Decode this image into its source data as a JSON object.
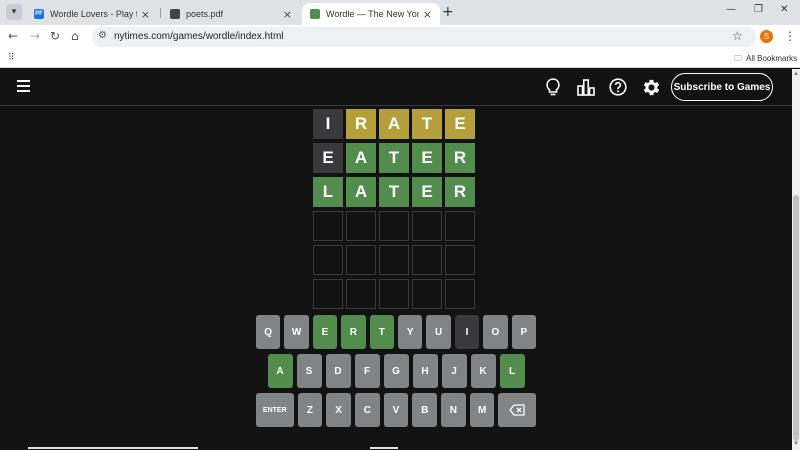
{
  "browser": {
    "tabs": [
      {
        "title": "Wordle Lovers - Play the NYT D",
        "favicon_text": "PF",
        "favicon_color": "#1a73e8",
        "active": false
      },
      {
        "title": "poets.pdf",
        "favicon_text": "",
        "favicon_color": "#444444",
        "active": false
      },
      {
        "title": "Wordle — The New York Times",
        "favicon_text": "",
        "favicon_color": "#538d4e",
        "active": true
      }
    ],
    "url": "nytimes.com/games/wordle/index.html",
    "profile_initial": "S",
    "bookmarks_label": "All Bookmarks"
  },
  "header": {
    "subscribe_label": "Subscribe to Games",
    "icons": [
      "menu-icon",
      "lightbulb-icon",
      "stats-icon",
      "help-icon",
      "settings-icon"
    ]
  },
  "board": {
    "rows": [
      [
        {
          "l": "I",
          "s": "absent"
        },
        {
          "l": "R",
          "s": "present"
        },
        {
          "l": "A",
          "s": "present"
        },
        {
          "l": "T",
          "s": "present"
        },
        {
          "l": "E",
          "s": "present"
        }
      ],
      [
        {
          "l": "E",
          "s": "absent"
        },
        {
          "l": "A",
          "s": "correct"
        },
        {
          "l": "T",
          "s": "correct"
        },
        {
          "l": "E",
          "s": "correct"
        },
        {
          "l": "R",
          "s": "correct"
        }
      ],
      [
        {
          "l": "L",
          "s": "correct"
        },
        {
          "l": "A",
          "s": "correct"
        },
        {
          "l": "T",
          "s": "correct"
        },
        {
          "l": "E",
          "s": "correct"
        },
        {
          "l": "R",
          "s": "correct"
        }
      ],
      [
        {
          "l": "",
          "s": "empty"
        },
        {
          "l": "",
          "s": "empty"
        },
        {
          "l": "",
          "s": "empty"
        },
        {
          "l": "",
          "s": "empty"
        },
        {
          "l": "",
          "s": "empty"
        }
      ],
      [
        {
          "l": "",
          "s": "empty"
        },
        {
          "l": "",
          "s": "empty"
        },
        {
          "l": "",
          "s": "empty"
        },
        {
          "l": "",
          "s": "empty"
        },
        {
          "l": "",
          "s": "empty"
        }
      ],
      [
        {
          "l": "",
          "s": "empty"
        },
        {
          "l": "",
          "s": "empty"
        },
        {
          "l": "",
          "s": "empty"
        },
        {
          "l": "",
          "s": "empty"
        },
        {
          "l": "",
          "s": "empty"
        }
      ]
    ]
  },
  "keyboard": {
    "rows": [
      [
        {
          "k": "Q",
          "s": "unused"
        },
        {
          "k": "W",
          "s": "unused"
        },
        {
          "k": "E",
          "s": "correct"
        },
        {
          "k": "R",
          "s": "correct"
        },
        {
          "k": "T",
          "s": "correct"
        },
        {
          "k": "Y",
          "s": "unused"
        },
        {
          "k": "U",
          "s": "unused"
        },
        {
          "k": "I",
          "s": "absent"
        },
        {
          "k": "O",
          "s": "unused"
        },
        {
          "k": "P",
          "s": "unused"
        }
      ],
      [
        {
          "k": "A",
          "s": "correct"
        },
        {
          "k": "S",
          "s": "unused"
        },
        {
          "k": "D",
          "s": "unused"
        },
        {
          "k": "F",
          "s": "unused"
        },
        {
          "k": "G",
          "s": "unused"
        },
        {
          "k": "H",
          "s": "unused"
        },
        {
          "k": "J",
          "s": "unused"
        },
        {
          "k": "K",
          "s": "unused"
        },
        {
          "k": "L",
          "s": "correct"
        }
      ],
      [
        {
          "k": "ENTER",
          "s": "unused"
        },
        {
          "k": "Z",
          "s": "unused"
        },
        {
          "k": "X",
          "s": "unused"
        },
        {
          "k": "C",
          "s": "unused"
        },
        {
          "k": "V",
          "s": "unused"
        },
        {
          "k": "B",
          "s": "unused"
        },
        {
          "k": "N",
          "s": "unused"
        },
        {
          "k": "M",
          "s": "unused"
        },
        {
          "k": "⌫",
          "s": "unused"
        }
      ]
    ]
  },
  "colors": {
    "correct": "#538d4e",
    "present": "#b59f3b",
    "absent": "#3a3a3c",
    "key_unused": "#818384",
    "background": "#121213"
  }
}
